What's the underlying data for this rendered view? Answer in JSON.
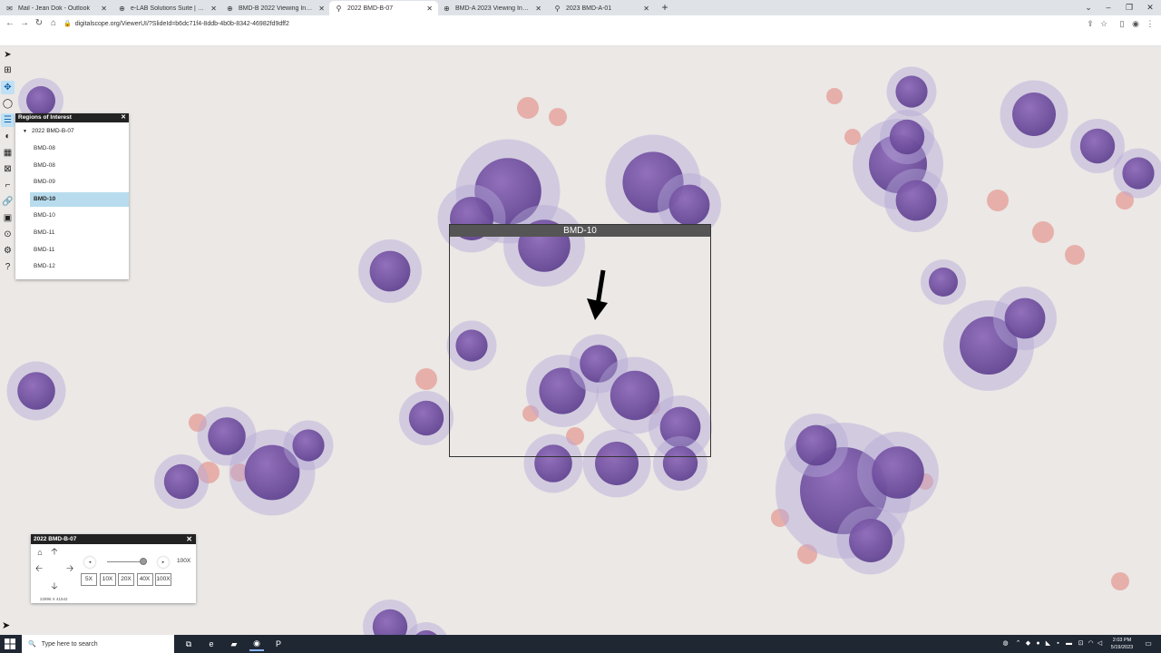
{
  "browser": {
    "tabs": [
      {
        "label": "Mail - Jean Dok - Outlook",
        "icon": "outlook-icon",
        "active": false
      },
      {
        "label": "e-LAB Solutions Suite | College o",
        "icon": "globe-icon",
        "active": false
      },
      {
        "label": "BMD-B 2022 Viewing Instructio",
        "icon": "globe-icon",
        "active": false
      },
      {
        "label": "2022 BMD-B-07",
        "icon": "microscope-icon",
        "active": true
      },
      {
        "label": "BMD-A 2023 Viewing Instructio",
        "icon": "globe-icon",
        "active": false
      },
      {
        "label": "2023 BMD-A-01",
        "icon": "microscope-icon",
        "active": false
      }
    ],
    "new_tab": "+",
    "window_controls": {
      "dropdown": "⌄",
      "minimize": "–",
      "restore": "❐",
      "close": "✕"
    },
    "url": "digitalscope.org/ViewerUI/?SlideId=b6dc71f4-8ddb-4b0b-8342-46982fd9dff2"
  },
  "toolbar": {
    "tools": [
      {
        "name": "navigate-icon",
        "glyph": "➤",
        "active": false
      },
      {
        "name": "grid-icon",
        "glyph": "⊞",
        "active": false
      },
      {
        "name": "pan-icon",
        "glyph": "✥",
        "active": true
      },
      {
        "name": "comment-icon",
        "glyph": "◯",
        "active": false
      },
      {
        "name": "list-icon",
        "glyph": "☰",
        "active": true
      },
      {
        "name": "color-adjust-icon",
        "glyph": "◐",
        "active": false
      },
      {
        "name": "table-icon",
        "glyph": "▦",
        "active": false
      },
      {
        "name": "image-icon",
        "glyph": "⊠",
        "active": false
      },
      {
        "name": "ruler-icon",
        "glyph": "⌐",
        "active": false
      },
      {
        "name": "link-icon",
        "glyph": "🔗",
        "active": false
      },
      {
        "name": "snapshot-icon",
        "glyph": "▣",
        "active": false
      },
      {
        "name": "marker-icon",
        "glyph": "⊙",
        "active": false
      },
      {
        "name": "settings-icon",
        "glyph": "⚙",
        "active": false
      },
      {
        "name": "help-icon",
        "glyph": "?",
        "active": false
      }
    ]
  },
  "roi_panel": {
    "title": "Regions of Interest",
    "close": "✕",
    "group": "2022 BMD-B-07",
    "items": [
      {
        "label": "BMD-08",
        "selected": false
      },
      {
        "label": "BMD-08",
        "selected": false
      },
      {
        "label": "BMD-09",
        "selected": false
      },
      {
        "label": "BMD-10",
        "selected": true
      },
      {
        "label": "BMD-10",
        "selected": false
      },
      {
        "label": "BMD-11",
        "selected": false
      },
      {
        "label": "BMD-11",
        "selected": false
      },
      {
        "label": "BMD-12",
        "selected": false
      }
    ]
  },
  "annotation": {
    "label": "BMD-10"
  },
  "navigator": {
    "title": "2022 BMD-B-07",
    "close": "✕",
    "home": "⌂",
    "arrows": {
      "up": "🡡",
      "down": "🡣",
      "left": "🡠",
      "right": "🡢"
    },
    "zoom_out": "◂",
    "zoom_in": "▸",
    "zoom_fraction": 0.92,
    "zoom_label": "100X",
    "magnifications": [
      "5X",
      "10X",
      "20X",
      "40X",
      "100X"
    ],
    "coordinates": "22896 X 41542"
  },
  "taskbar": {
    "search_placeholder": "Type here to search",
    "search_icon": "🔍",
    "apps": [
      {
        "name": "task-view-icon",
        "glyph": "⧉"
      },
      {
        "name": "edge-icon",
        "glyph": "e"
      },
      {
        "name": "file-explorer-icon",
        "glyph": "▰"
      },
      {
        "name": "chrome-icon",
        "glyph": "◉"
      },
      {
        "name": "powerpoint-icon",
        "glyph": "P"
      }
    ],
    "time": "2:03 PM",
    "date": "5/19/2023"
  },
  "colors": {
    "selection": "#b8dcee",
    "panel_header": "#222222",
    "annotation_label": "#555555",
    "taskbar": "#1f2733"
  }
}
